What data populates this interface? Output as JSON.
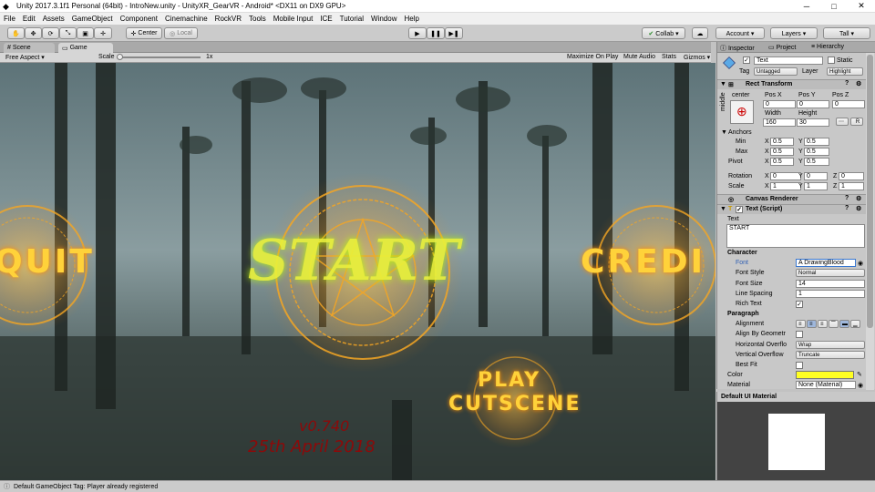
{
  "window": {
    "title": "Unity 2017.3.1f1 Personal (64bit) - IntroNew.unity - UnityXR_GearVR - Android* <DX11 on DX9 GPU>",
    "minimize": "─",
    "maximize": "□",
    "close": "✕"
  },
  "menu": [
    "File",
    "Edit",
    "Assets",
    "GameObject",
    "Component",
    "Cinemachine",
    "RockVR",
    "Tools",
    "Mobile Input",
    "ICE",
    "Tutorial",
    "Window",
    "Help"
  ],
  "toolbar": {
    "tools": [
      "✋",
      "✥",
      "⟳",
      "⤡",
      "▣",
      "✛"
    ],
    "pivot": "Center",
    "space": "Local",
    "play": "▶",
    "pause": "❚❚",
    "step": "▶❚",
    "collab": "Collab ▾",
    "cloud": "☁",
    "account": "Account ▾",
    "layers": "Layers ▾",
    "layout": "Tall ▾"
  },
  "tabs": {
    "scene": "Scene",
    "game": "Game"
  },
  "gamebar": {
    "aspect": "Free Aspect ▾",
    "scale_label": "Scale",
    "scale_value": "1x",
    "buttons": [
      "Maximize On Play",
      "Mute Audio",
      "Stats",
      "Gizmos ▾"
    ]
  },
  "game": {
    "quit": "QUIT",
    "start": "START",
    "credits": "CREDI",
    "play": "PLAY",
    "cutscene": "CUTSCENE",
    "version": "v0.740",
    "date": "25th April 2018"
  },
  "status": {
    "message": "Default GameObject Tag: Player already registered"
  },
  "inspector": {
    "tabs": [
      "Inspector",
      "Project",
      "Hierarchy"
    ],
    "name": "Text",
    "static": "Static",
    "tag_label": "Tag",
    "tag": "Untagged",
    "layer_label": "Layer",
    "layer": "Highlight",
    "rect": {
      "title": "Rect Transform",
      "anchor_h": "center",
      "anchor_v": "middle",
      "posx_l": "Pos X",
      "posy_l": "Pos Y",
      "posz_l": "Pos Z",
      "posx": "0",
      "posy": "0",
      "posz": "0",
      "width_l": "Width",
      "height_l": "Height",
      "width": "160",
      "height": "30",
      "r_btn": "R",
      "anchors": "Anchors",
      "min": "Min",
      "max": "Max",
      "pivot": "Pivot",
      "x": "X",
      "y": "Y",
      "z": "Z",
      "min_x": "0.5",
      "min_y": "0.5",
      "max_x": "0.5",
      "max_y": "0.5",
      "pivot_x": "0.5",
      "pivot_y": "0.5",
      "rotation": "Rotation",
      "rot_x": "0",
      "rot_y": "0",
      "rot_z": "0",
      "scale": "Scale",
      "sc_x": "1",
      "sc_y": "1",
      "sc_z": "1"
    },
    "canvas_renderer": "Canvas Renderer",
    "text_script": "Text (Script)",
    "text_label": "Text",
    "text_value": "START",
    "character": "Character",
    "font_l": "Font",
    "font": "DrawingBlood",
    "fontstyle_l": "Font Style",
    "fontstyle": "Normal",
    "fontsize_l": "Font Size",
    "fontsize": "14",
    "linespacing_l": "Line Spacing",
    "linespacing": "1",
    "richtext_l": "Rich Text",
    "paragraph": "Paragraph",
    "alignment_l": "Alignment",
    "alignbygeo_l": "Align By Geometr",
    "hoverflow_l": "Horizontal Overflo",
    "hoverflow": "Wrap",
    "voverflow_l": "Vertical Overflow",
    "voverflow": "Truncate",
    "bestfit_l": "Best Fit",
    "color_l": "Color",
    "color": "#ffff22",
    "material_l": "Material",
    "material": "None (Material)"
  },
  "material_panel": {
    "title": "Default UI Material"
  },
  "colors": {
    "accent": "#ffff22",
    "fire": "#f5a623",
    "red_text": "#8b0a0a",
    "game_bg": "#465a5d"
  }
}
